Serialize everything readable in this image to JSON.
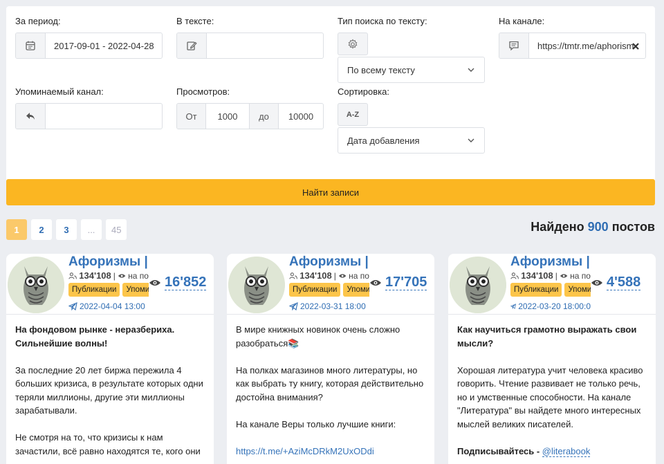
{
  "filters": {
    "period_label": "За период:",
    "period_value": "2017-09-01 - 2022-04-28",
    "text_label": "В тексте:",
    "text_value": "",
    "search_type_label": "Тип поиска по тексту:",
    "search_type_value": "По всему тексту",
    "channel_label": "На канале:",
    "channel_value": "https://tmtr.me/aphorism",
    "mentioned_label": "Упоминаемый канал:",
    "mentioned_value": "",
    "views_label": "Просмотров:",
    "views_from_label": "От",
    "views_from": "1000",
    "views_to_label": "до",
    "views_to": "10000",
    "sort_label": "Сортировка:",
    "sort_icon_text": "A-Z",
    "sort_value": "Дата добавления"
  },
  "find_button": "Найти записи",
  "pagination": [
    "1",
    "2",
    "3",
    "...",
    "45"
  ],
  "found": {
    "prefix": "Найдено",
    "count": "900",
    "suffix": "постов"
  },
  "colors": {
    "accent": "#fbb622",
    "link": "#3573b9",
    "tag": "#fcc54a"
  },
  "cards": [
    {
      "title": "Афоризмы | Л",
      "subscribers": "134'108",
      "meta_tail": "на по",
      "tags": [
        "Публикации",
        "Упомина"
      ],
      "date": "2022-04-04 13:00",
      "views": "16'852",
      "p1": "На фондовом рынке - неразбериха. Сильнейшие волны!",
      "p2": "За последние 20 лет биржа пережила 4 больших кризиса, в результате которых одни теряли миллионы, другие эти миллионы зарабатывали.",
      "p3": "Не смотря на то, что кризисы к нам зачастили, всё равно находятся те, кого они"
    },
    {
      "title": "Афоризмы | Л",
      "subscribers": "134'108",
      "meta_tail": "на по",
      "tags": [
        "Публикации",
        "Упомина"
      ],
      "date": "2022-03-31 18:00",
      "views": "17'705",
      "p1": "В мире книжных новинок очень сложно разобраться📚",
      "p2": "На полках магазинов много литературы, но как выбрать ту книгу, которая действительно достойна внимания?",
      "p3": "На канале Веры только лучшие книги:",
      "p4": "https://t.me/+AziMcDRkM2UxODdi"
    },
    {
      "title": "Афоризмы | Л",
      "subscribers": "134'108",
      "meta_tail": "на по",
      "tags": [
        "Публикации",
        "Упомина"
      ],
      "date": "2022-03-20 18:00:0",
      "views": "4'588",
      "p1": "Как научиться грамотно выражать свои мысли?",
      "p2": "Хорошая литература учит человека красиво говорить. Чтение развивает не только речь, но и умственные способности. На канале \"Литература\" вы найдете много интересных мыслей великих писателей.",
      "p3_prefix": "Подписывайтесь -",
      "p3_handle": "@literabook"
    }
  ]
}
